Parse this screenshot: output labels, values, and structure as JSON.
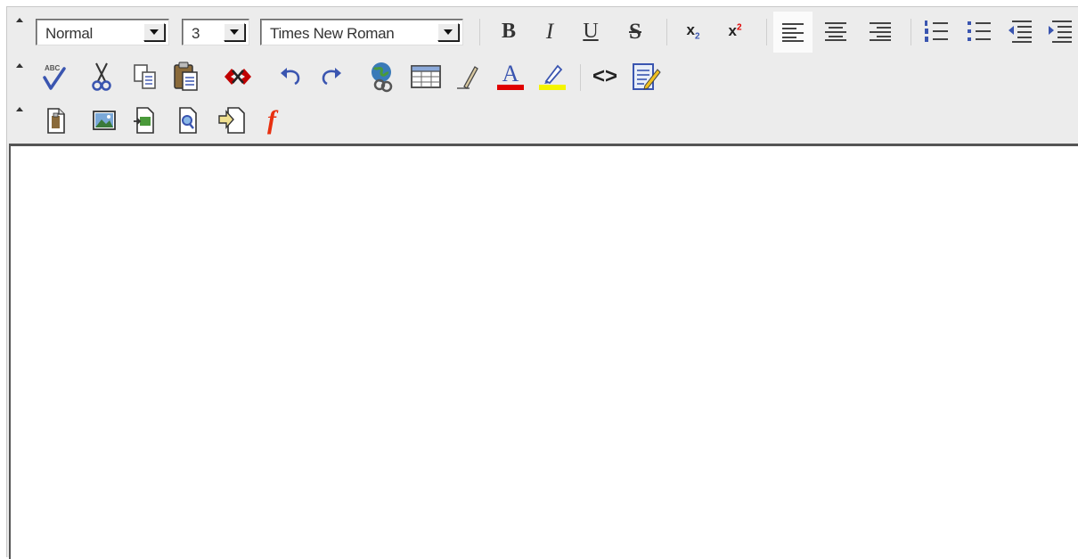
{
  "toolbar": {
    "paragraph_format": "Normal",
    "font_size": "3",
    "font_family": "Times New Roman",
    "bold_label": "B",
    "italic_label": "I",
    "underline_label": "U",
    "strike_label": "S",
    "subscript_label": "x",
    "subscript_mark": "2",
    "superscript_label": "x",
    "superscript_mark": "2",
    "spellcheck_label": "ABC",
    "font_color_label": "A",
    "source_label": "<>",
    "flash_label": "f"
  },
  "colors": {
    "font_color": "#e00000",
    "highlight_color": "#f4f400",
    "icon_blue": "#3a55b0",
    "toolbar_bg": "#ececec"
  },
  "icons": [
    "bold-icon",
    "italic-icon",
    "underline-icon",
    "strikethrough-icon",
    "subscript-icon",
    "superscript-icon",
    "align-left-icon",
    "align-center-icon",
    "align-right-icon",
    "ordered-list-icon",
    "unordered-list-icon",
    "outdent-icon",
    "indent-icon",
    "spellcheck-icon",
    "cut-icon",
    "copy-icon",
    "paste-icon",
    "unlink-icon",
    "undo-icon",
    "redo-icon",
    "link-icon",
    "table-icon",
    "draw-icon",
    "font-color-icon",
    "highlight-icon",
    "source-code-icon",
    "edit-note-icon",
    "insert-file-icon",
    "insert-image-icon",
    "insert-document-icon",
    "preview-icon",
    "insert-template-icon",
    "flash-icon"
  ]
}
